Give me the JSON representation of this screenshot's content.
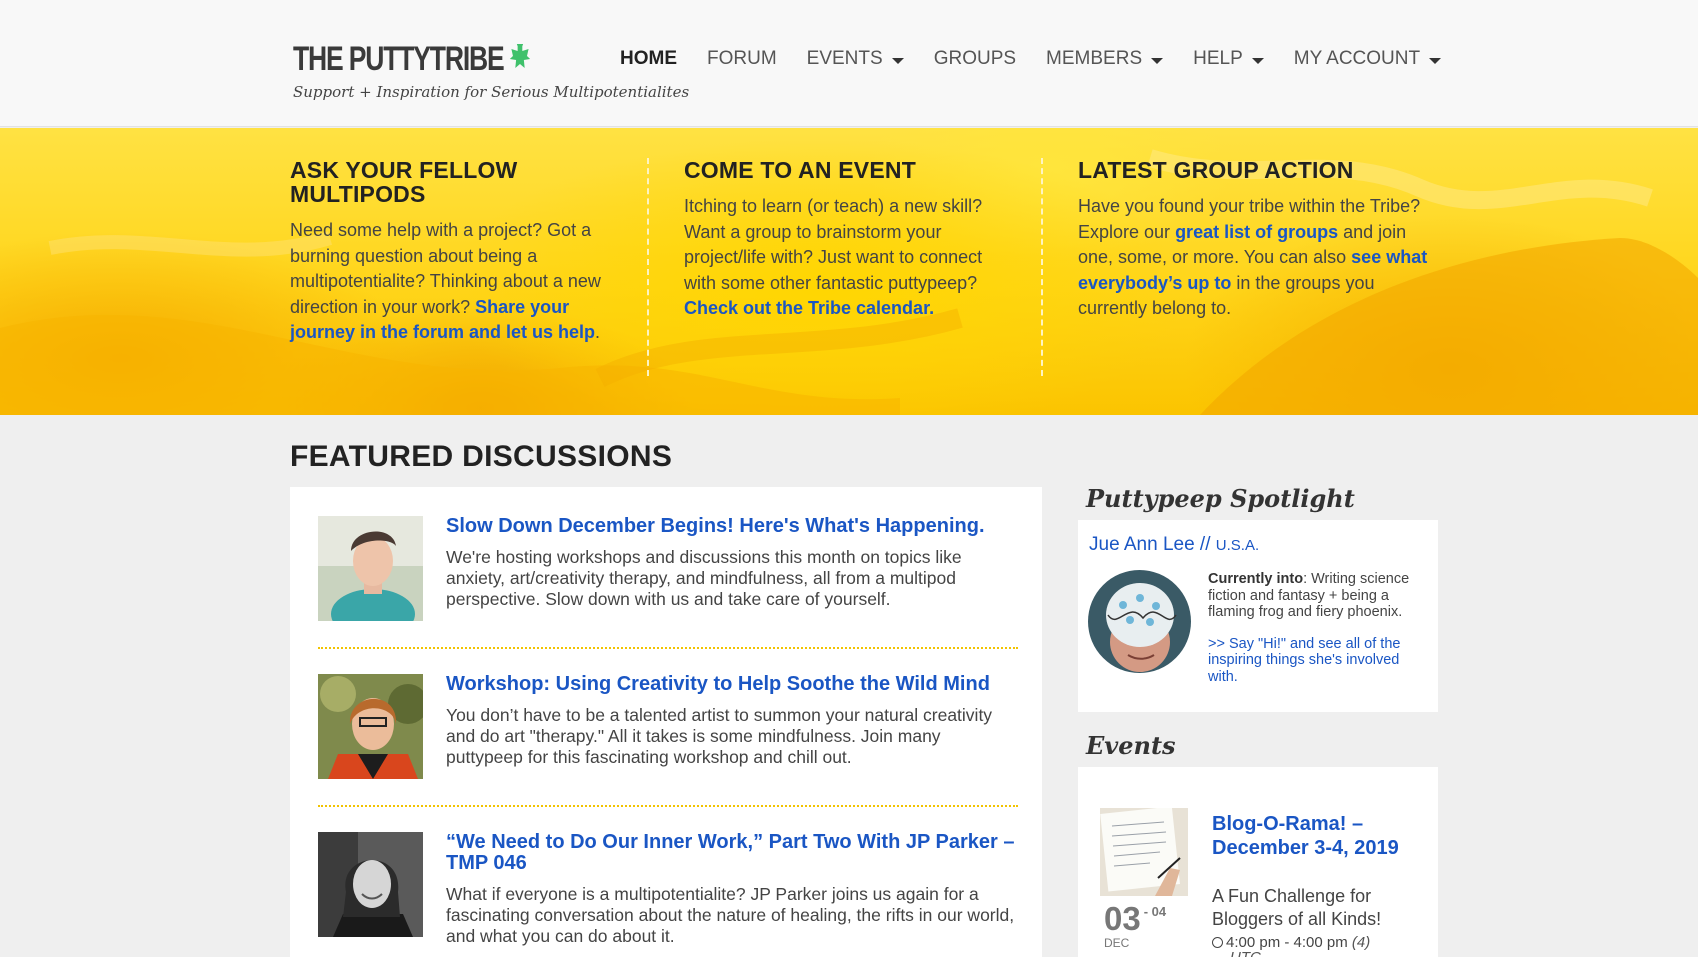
{
  "header": {
    "logo_title": "THE PUTTYTRIBE",
    "tagline": "Support + Inspiration for Serious Multipotentialites",
    "nav": [
      {
        "label": "HOME",
        "active": true,
        "dropdown": false
      },
      {
        "label": "FORUM",
        "active": false,
        "dropdown": false
      },
      {
        "label": "EVENTS",
        "active": false,
        "dropdown": true
      },
      {
        "label": "GROUPS",
        "active": false,
        "dropdown": false
      },
      {
        "label": "MEMBERS",
        "active": false,
        "dropdown": true
      },
      {
        "label": "HELP",
        "active": false,
        "dropdown": true
      },
      {
        "label": "MY ACCOUNT",
        "active": false,
        "dropdown": true
      }
    ]
  },
  "banner": {
    "col1": {
      "heading": "ASK YOUR FELLOW MULTIPODS",
      "text": "Need some help with a project? Got a burning question about being a multipotentialite? Thinking about a new direction in your work? ",
      "link": "Share your journey in the forum and let us help",
      "after": "."
    },
    "col2": {
      "heading": "COME TO AN EVENT",
      "text": "Itching to learn (or teach) a new skill? Want a group to brainstorm your project/life with? Just want to connect with some other fantastic puttypeep? ",
      "link": "Check out the Tribe calendar."
    },
    "col3": {
      "heading": "LATEST GROUP ACTION",
      "text1": "Have you found your tribe within the Tribe? Explore our ",
      "link1": "great list of groups",
      "text2": " and join one, some, or more. You can also ",
      "link2": "see what everybody’s up to",
      "text3": " in the groups you currently belong to."
    }
  },
  "featured": {
    "title": "FEATURED DISCUSSIONS",
    "items": [
      {
        "title": "Slow Down December Begins! Here's What's Happening.",
        "text": "We're hosting workshops and discussions this month on topics like anxiety, art/creativity therapy, and mindfulness, all from a multipod perspective. Slow down with us and take care of yourself."
      },
      {
        "title": "Workshop: Using Creativity to Help Soothe the Wild Mind",
        "text": "You don’t have to be a talented artist to summon your natural creativity and do art \"therapy.\" All it takes is some mindfulness. Join many puttypeep for this fascinating workshop and chill out."
      },
      {
        "title": "“We Need to Do Our Inner Work,” Part Two With JP Parker – TMP 046",
        "text": "What if everyone is a multipotentialite? JP Parker joins us again for a fascinating conversation about the nature of healing, the rifts in our world, and what you can do about it."
      }
    ]
  },
  "spotlight": {
    "heading": "Puttypeep Spotlight",
    "name": "Jue Ann Lee",
    "sep": " // ",
    "country": "U.S.A.",
    "into_label": "Currently into",
    "into_text": ": Writing science fiction and fantasy + being a flaming frog and fiery phoenix.",
    "link": ">> Say \"Hi!\" and see all of the inspiring things she's involved with."
  },
  "events": {
    "heading": "Events",
    "item": {
      "day": "03",
      "end_day": "- 04",
      "month": "DEC",
      "title": "Blog-O-Rama! – December 3-4, 2019",
      "desc": "A Fun Challenge for Bloggers of all Kinds!",
      "time": "4:00 pm - 4:00 pm",
      "time_extra": "(4)",
      "tz": "UTC"
    }
  },
  "colors": {
    "link": "#1a56c4",
    "banner": "#ffd51a",
    "separator": "#f2c300",
    "header_bg": "#f8f8f8"
  }
}
